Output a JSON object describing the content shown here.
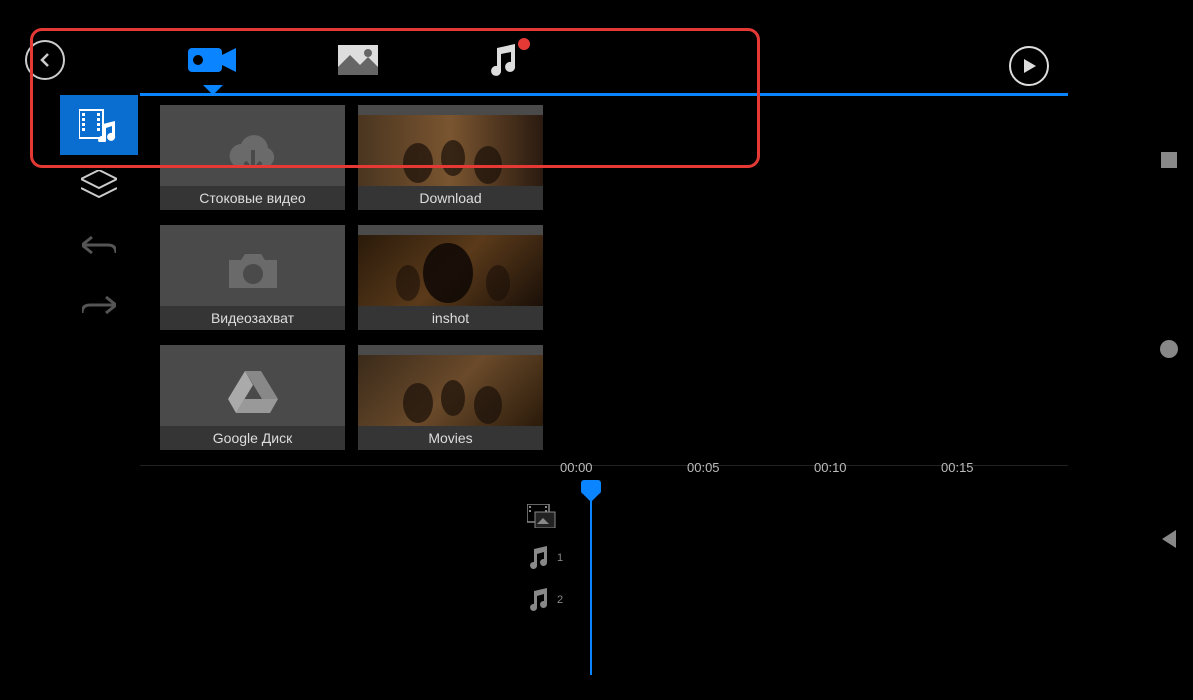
{
  "toolbar": {
    "tabs": [
      "video",
      "image",
      "music"
    ],
    "active": 0,
    "music_has_notification": true
  },
  "sidebar": {
    "items": [
      {
        "name": "media-library",
        "active": true
      },
      {
        "name": "layers",
        "active": false
      },
      {
        "name": "undo",
        "active": false
      },
      {
        "name": "redo",
        "active": false
      }
    ]
  },
  "folders": [
    {
      "label": "Стоковые видео",
      "kind": "cloud"
    },
    {
      "label": "Download",
      "kind": "thumb"
    },
    {
      "label": "Видеозахват",
      "kind": "camera"
    },
    {
      "label": "inshot",
      "kind": "thumb"
    },
    {
      "label": "Google Диск",
      "kind": "gdrive"
    },
    {
      "label": "Movies",
      "kind": "thumb"
    }
  ],
  "timeline": {
    "marks": [
      "00:00",
      "00:05",
      "00:10",
      "00:15"
    ],
    "tracks": [
      {
        "kind": "video",
        "label": ""
      },
      {
        "kind": "audio",
        "label": "1"
      },
      {
        "kind": "audio",
        "label": "2"
      }
    ],
    "playhead": "00:00"
  },
  "navigation": {
    "back": "triangle",
    "home": "circle",
    "recent": "square"
  }
}
